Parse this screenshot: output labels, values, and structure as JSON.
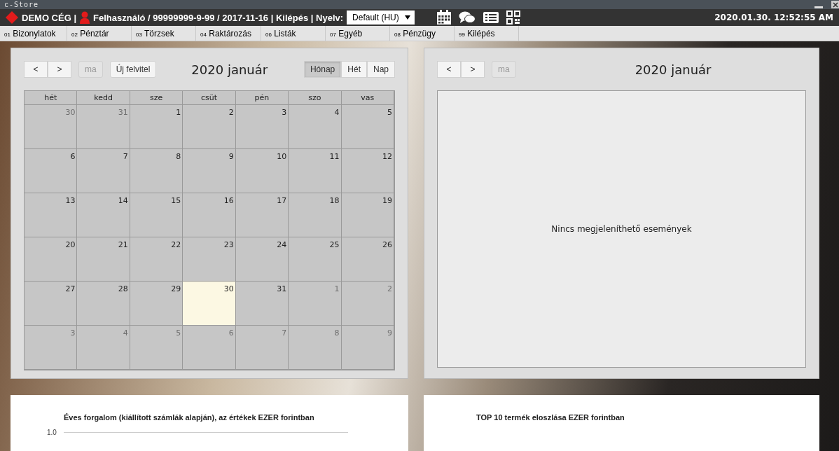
{
  "window": {
    "title": "c-Store"
  },
  "header": {
    "company": "DEMO CÉG |",
    "user_info": "Felhasználó / 99999999-9-99 / 2017-11-16 | Kilépés | Nyelv:",
    "language": "Default (HU)",
    "datetime": "2020.01.30. 12:52:55 AM"
  },
  "menu": [
    {
      "number": "01",
      "label": "Bizonylatok"
    },
    {
      "number": "02",
      "label": "Pénztár"
    },
    {
      "number": "03",
      "label": "Törzsek"
    },
    {
      "number": "04",
      "label": "Raktározás"
    },
    {
      "number": "06",
      "label": "Listák"
    },
    {
      "number": "07",
      "label": "Egyéb"
    },
    {
      "number": "08",
      "label": "Pénzügy"
    },
    {
      "number": "99",
      "label": "Kilépés"
    }
  ],
  "calendar": {
    "prev": "<",
    "next": ">",
    "today_button": "ma",
    "new_button": "Új felvitel",
    "title": "2020 január",
    "views": [
      {
        "label": "Hónap",
        "selected": true
      },
      {
        "label": "Hét",
        "selected": false
      },
      {
        "label": "Nap",
        "selected": false
      }
    ],
    "weekdays": [
      "hét",
      "kedd",
      "sze",
      "csüt",
      "pén",
      "szo",
      "vas"
    ],
    "weeks": [
      [
        {
          "label": "30",
          "muted": true,
          "today": false
        },
        {
          "label": "31",
          "muted": true,
          "today": false
        },
        {
          "label": "1",
          "muted": false,
          "today": false
        },
        {
          "label": "2",
          "muted": false,
          "today": false
        },
        {
          "label": "3",
          "muted": false,
          "today": false
        },
        {
          "label": "4",
          "muted": false,
          "today": false
        },
        {
          "label": "5",
          "muted": false,
          "today": false
        }
      ],
      [
        {
          "label": "6",
          "muted": false,
          "today": false
        },
        {
          "label": "7",
          "muted": false,
          "today": false
        },
        {
          "label": "8",
          "muted": false,
          "today": false
        },
        {
          "label": "9",
          "muted": false,
          "today": false
        },
        {
          "label": "10",
          "muted": false,
          "today": false
        },
        {
          "label": "11",
          "muted": false,
          "today": false
        },
        {
          "label": "12",
          "muted": false,
          "today": false
        }
      ],
      [
        {
          "label": "13",
          "muted": false,
          "today": false
        },
        {
          "label": "14",
          "muted": false,
          "today": false
        },
        {
          "label": "15",
          "muted": false,
          "today": false
        },
        {
          "label": "16",
          "muted": false,
          "today": false
        },
        {
          "label": "17",
          "muted": false,
          "today": false
        },
        {
          "label": "18",
          "muted": false,
          "today": false
        },
        {
          "label": "19",
          "muted": false,
          "today": false
        }
      ],
      [
        {
          "label": "20",
          "muted": false,
          "today": false
        },
        {
          "label": "21",
          "muted": false,
          "today": false
        },
        {
          "label": "22",
          "muted": false,
          "today": false
        },
        {
          "label": "23",
          "muted": false,
          "today": false
        },
        {
          "label": "24",
          "muted": false,
          "today": false
        },
        {
          "label": "25",
          "muted": false,
          "today": false
        },
        {
          "label": "26",
          "muted": false,
          "today": false
        }
      ],
      [
        {
          "label": "27",
          "muted": false,
          "today": false
        },
        {
          "label": "28",
          "muted": false,
          "today": false
        },
        {
          "label": "29",
          "muted": false,
          "today": false
        },
        {
          "label": "30",
          "muted": false,
          "today": true
        },
        {
          "label": "31",
          "muted": false,
          "today": false
        },
        {
          "label": "1",
          "muted": true,
          "today": false
        },
        {
          "label": "2",
          "muted": true,
          "today": false
        }
      ],
      [
        {
          "label": "3",
          "muted": true,
          "today": false
        },
        {
          "label": "4",
          "muted": true,
          "today": false
        },
        {
          "label": "5",
          "muted": true,
          "today": false
        },
        {
          "label": "6",
          "muted": true,
          "today": false
        },
        {
          "label": "7",
          "muted": true,
          "today": false
        },
        {
          "label": "8",
          "muted": true,
          "today": false
        },
        {
          "label": "9",
          "muted": true,
          "today": false
        }
      ]
    ]
  },
  "event_list": {
    "prev": "<",
    "next": ">",
    "today_button": "ma",
    "title": "2020 január",
    "empty_message": "Nincs megjeleníthető események"
  },
  "revenue_card": {
    "title": "Éves forgalom (kiállított számlák alapján), az értékek EZER forintban",
    "y_tick": "1.0"
  },
  "top_products_card": {
    "title": "TOP 10 termék eloszlása EZER forintban"
  }
}
